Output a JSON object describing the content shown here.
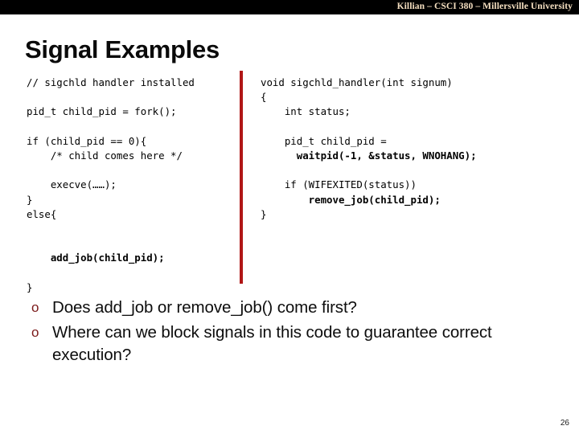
{
  "header": {
    "title": "Killian – CSCI 380 – Millersville University",
    "background_color": "#000000",
    "text_color": "#f5dfc0"
  },
  "slide": {
    "title": "Signal Examples",
    "page_number": "26",
    "divider_color": "#b01616",
    "bullet_marker_color": "#7b1a1a"
  },
  "code_left": {
    "lines": [
      {
        "text": "// sigchld handler installed",
        "bold": false
      },
      {
        "text": "",
        "bold": false
      },
      {
        "text": "pid_t child_pid = fork();",
        "bold": false
      },
      {
        "text": "",
        "bold": false
      },
      {
        "text": "if (child_pid == 0){",
        "bold": false
      },
      {
        "text": "    /* child comes here */",
        "bold": false
      },
      {
        "text": "",
        "bold": false
      },
      {
        "text": "    execve(……);",
        "bold": false
      },
      {
        "text": "}",
        "bold": false
      },
      {
        "text": "else{",
        "bold": false
      },
      {
        "text": "",
        "bold": false
      },
      {
        "text": "",
        "bold": false
      },
      {
        "text": "    add_job(child_pid);",
        "bold": true
      },
      {
        "text": "",
        "bold": false
      },
      {
        "text": "}",
        "bold": false
      }
    ]
  },
  "code_right": {
    "lines": [
      {
        "text": "void sigchld_handler(int signum)",
        "bold": false
      },
      {
        "text": "{",
        "bold": false
      },
      {
        "text": "    int status;",
        "bold": false
      },
      {
        "text": "",
        "bold": false
      },
      {
        "text": "    pid_t child_pid =",
        "bold": false
      },
      {
        "text": "      waitpid(-1, &status, WNOHANG);",
        "bold": true
      },
      {
        "text": "",
        "bold": false
      },
      {
        "text": "    if (WIFEXITED(status))",
        "bold": false
      },
      {
        "text": "        remove_job(child_pid);",
        "bold": true
      },
      {
        "text": "}",
        "bold": false
      }
    ]
  },
  "bullets": {
    "marker": "o",
    "items": [
      {
        "text": "Does add_job or remove_job() come first?"
      },
      {
        "text": "Where can we block signals in this code to guarantee correct execution?"
      }
    ]
  }
}
